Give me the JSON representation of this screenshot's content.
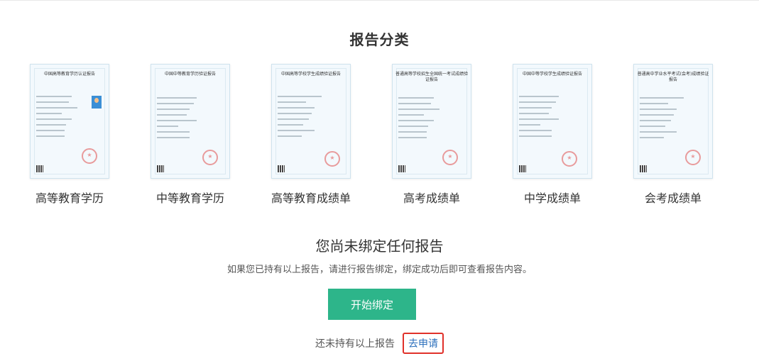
{
  "section": {
    "title": "报告分类"
  },
  "categories": [
    {
      "label": "高等教育学历",
      "doc_title": "中国高等教育学历认证报告"
    },
    {
      "label": "中等教育学历",
      "doc_title": "中国中等教育学历验证报告"
    },
    {
      "label": "高等教育成绩单",
      "doc_title": "中国高等学校学生成绩验证报告"
    },
    {
      "label": "高考成绩单",
      "doc_title": "普通高等学校招生全国统一考试成绩验证报告"
    },
    {
      "label": "中学成绩单",
      "doc_title": "中国中等学校学生成绩验证报告"
    },
    {
      "label": "会考成绩单",
      "doc_title": "普通高中学业水平考试(会考)成绩验证报告"
    }
  ],
  "empty": {
    "title": "您尚未绑定任何报告",
    "desc": "如果您已持有以上报告，请进行报告绑定，绑定成功后即可查看报告内容。"
  },
  "actions": {
    "bind_label": "开始绑定",
    "footer_text": "还未持有以上报告",
    "apply_label": "去申请"
  },
  "colors": {
    "primary": "#2db58a",
    "link": "#2a6ebb",
    "highlight": "#e0312a"
  }
}
